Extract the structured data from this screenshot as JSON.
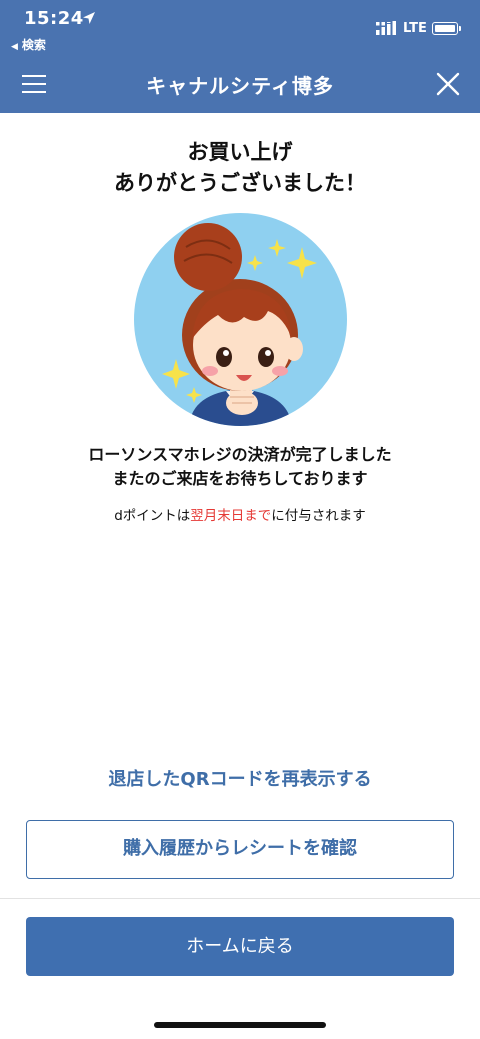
{
  "status": {
    "time": "15:24",
    "back_label": "検索",
    "network": "LTE",
    "icons": [
      "location-arrow-icon",
      "signal-icon",
      "battery-icon"
    ]
  },
  "nav": {
    "title": "キャナルシティ博多",
    "menu_icon": "hamburger-menu-icon",
    "close_icon": "close-icon"
  },
  "headline": {
    "line1": "お買い上げ",
    "line2": "ありがとうございました！"
  },
  "message": {
    "line1": "ローソンスマホレジの決済が完了しました",
    "line2": "またのご来店をお待ちしております"
  },
  "points": {
    "prefix": "dポイントは",
    "highlight": "翌月末日まで",
    "suffix": "に付与されます",
    "highlight_color": "#e53935"
  },
  "actions": {
    "qr_link": "退店したQRコードを再表示する",
    "receipt_button": "購入履歴からレシートを確認",
    "home_button": "ホームに戻る"
  },
  "colors": {
    "header": "#4a73b0",
    "accent": "#3f6ea8",
    "primary_button": "#3f6fb0",
    "illustration_bg": "#8fd0f0"
  }
}
